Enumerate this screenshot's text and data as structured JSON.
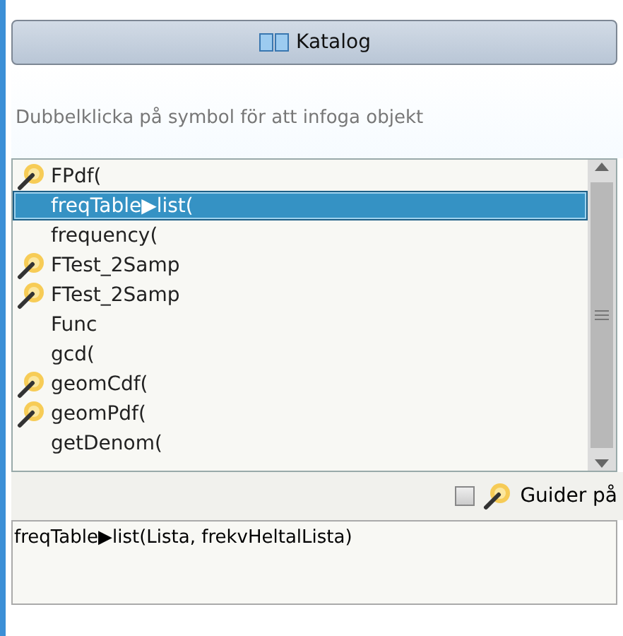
{
  "header": {
    "title": "Katalog"
  },
  "hint": "Dubbelklicka på symbol för att infoga objekt",
  "items": [
    {
      "label": "FPdf(",
      "wizard": true,
      "selected": false
    },
    {
      "label": "freqTable▶list(",
      "wizard": false,
      "selected": true
    },
    {
      "label": "frequency(",
      "wizard": false,
      "selected": false
    },
    {
      "label": "FTest_2Samp",
      "wizard": true,
      "selected": false
    },
    {
      "label": "FTest_2Samp",
      "wizard": true,
      "selected": false
    },
    {
      "label": "Func",
      "wizard": false,
      "selected": false
    },
    {
      "label": "gcd(",
      "wizard": false,
      "selected": false
    },
    {
      "label": "geomCdf(",
      "wizard": true,
      "selected": false
    },
    {
      "label": "geomPdf(",
      "wizard": true,
      "selected": false
    },
    {
      "label": "getDenom(",
      "wizard": false,
      "selected": false
    }
  ],
  "wizards_toggle": {
    "label": "Guider på",
    "checked": false
  },
  "syntax": "freqTable▶list(Lista, frekvHeltalLista)"
}
